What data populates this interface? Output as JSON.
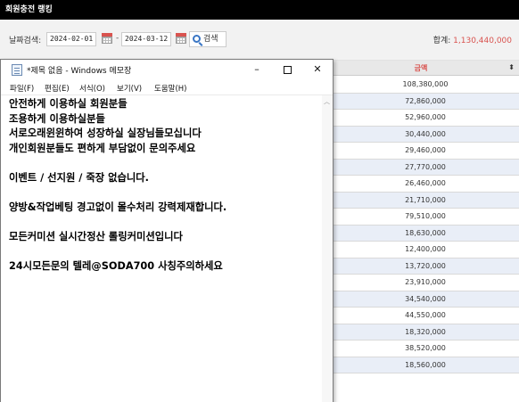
{
  "header": {
    "title": "회원충전 랭킹"
  },
  "filter": {
    "label": "날짜검색:",
    "start_date": "2024-02-01",
    "end_date": "2024-03-12",
    "separator": "-",
    "search_label": "검색",
    "total_label": "합계:",
    "total_value": "1,130,440,000"
  },
  "table": {
    "column_header": "금액",
    "sort_glyph": "⬍",
    "values": [
      "108,380,000",
      "72,860,000",
      "52,960,000",
      "30,440,000",
      "29,460,000",
      "27,770,000",
      "26,460,000",
      "21,710,000",
      "79,510,000",
      "18,630,000",
      "12,400,000",
      "13,720,000",
      "23,910,000",
      "34,540,000",
      "44,550,000",
      "18,320,000",
      "38,520,000",
      "18,560,000"
    ]
  },
  "notepad": {
    "title": "*제목 없음 - Windows 메모장",
    "menu": [
      "파일(F)",
      "편집(E)",
      "서식(O)",
      "보기(V)",
      "도움말(H)"
    ],
    "lines": [
      "안전하게 이용하실 회원분들",
      "조용하게 이용하실분들",
      "서로오래윈윈하여 성장하실 실장님들모십니다",
      "개인회원분들도 편하게 부담없이 문의주세요",
      "",
      "이벤트 / 선지원 / 죽장 없습니다.",
      "",
      "양방&작업베팅 경고없이 몰수처리 강력제재합니다.",
      "",
      "모든커미션 실시간정산 롤링커미션입니다",
      "",
      "24시모든문의 텔레@SODA700 사칭주의하세요"
    ]
  },
  "colors": {
    "accent_red": "#d9534f",
    "row_alt": "#e9eef7",
    "topbar": "#000000"
  }
}
